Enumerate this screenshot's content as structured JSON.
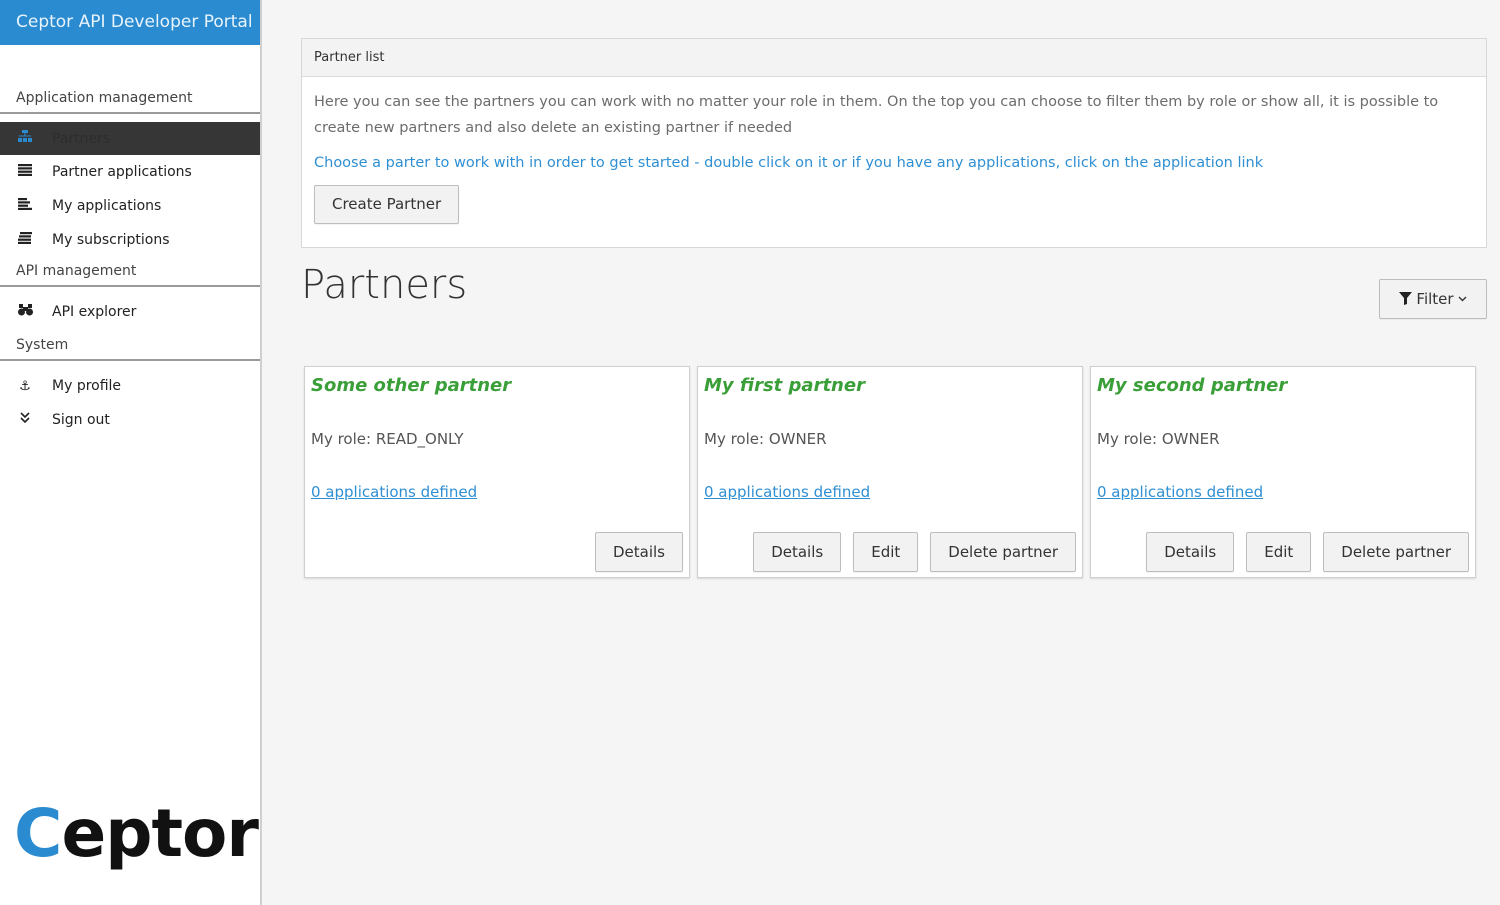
{
  "app": {
    "title": "Ceptor API Developer Portal",
    "logo_c": "C",
    "logo_rest": "eptor",
    "accent_color": "#2b8bd0"
  },
  "sidebar": {
    "sections": {
      "app_management": "Application management",
      "api_management": "API management",
      "system": "System"
    },
    "items": [
      {
        "label": "Partners",
        "icon": "sitemap-icon",
        "active": true
      },
      {
        "label": "Partner applications",
        "icon": "list-icon"
      },
      {
        "label": "My applications",
        "icon": "list-alt-icon"
      },
      {
        "label": "My subscriptions",
        "icon": "stack-icon"
      },
      {
        "label": "API explorer",
        "icon": "binoculars-icon"
      },
      {
        "label": "My profile",
        "icon": "anchor-icon"
      },
      {
        "label": "Sign out",
        "icon": "chevron-double-down-icon"
      }
    ]
  },
  "panel": {
    "heading": "Partner list",
    "description": "Here you can see the partners you can work with no matter your role in them. On the top you can choose to filter them by role or show all, it is possible to create new partners and also delete an existing partner if needed",
    "hint": "Choose a parter to work with in order to get started - double click on it or if you have any applications, click on the application link",
    "create_label": "Create Partner"
  },
  "main": {
    "title": "Partners",
    "filter_label": "Filter"
  },
  "partners": [
    {
      "name": "Some other partner",
      "role": "My role: READ_ONLY",
      "apps": "0 applications defined",
      "details": "Details"
    },
    {
      "name": "My first partner",
      "role": "My role: OWNER",
      "apps": "0 applications defined",
      "details": "Details",
      "edit": "Edit",
      "delete": "Delete partner"
    },
    {
      "name": "My second partner",
      "role": "My role: OWNER",
      "apps": "0 applications defined",
      "details": "Details",
      "edit": "Edit",
      "delete": "Delete partner"
    }
  ]
}
